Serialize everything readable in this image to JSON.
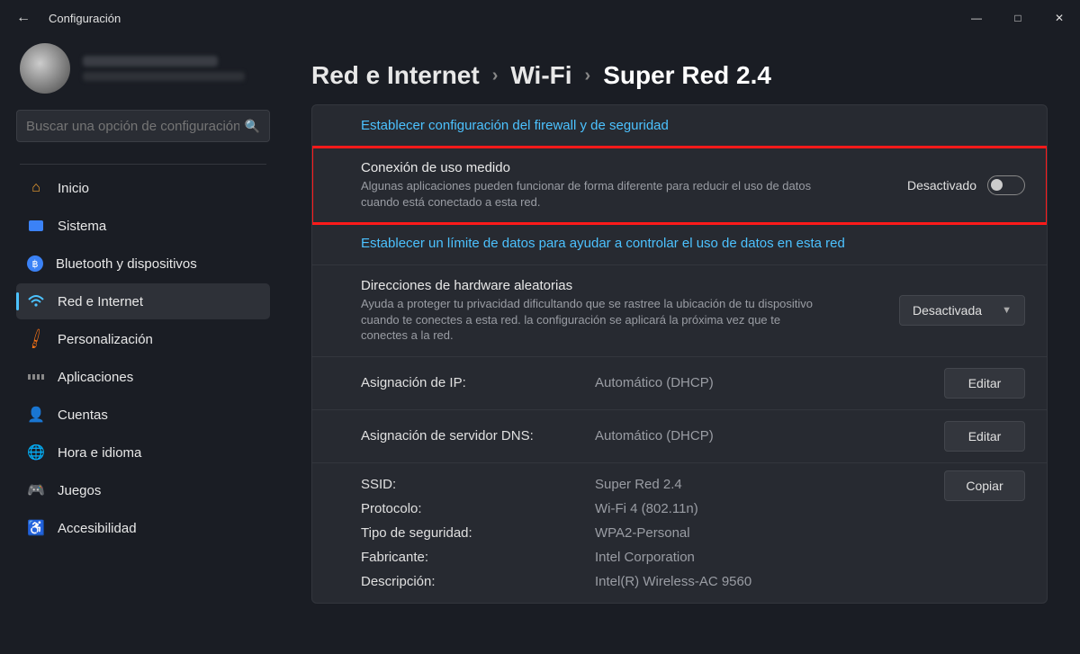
{
  "window": {
    "title": "Configuración",
    "back_tooltip": "Atrás"
  },
  "sidebar": {
    "search_placeholder": "Buscar una opción de configuración",
    "items": [
      {
        "label": "Inicio",
        "icon": "home-icon"
      },
      {
        "label": "Sistema",
        "icon": "system-icon"
      },
      {
        "label": "Bluetooth y dispositivos",
        "icon": "bluetooth-icon"
      },
      {
        "label": "Red e Internet",
        "icon": "network-icon"
      },
      {
        "label": "Personalización",
        "icon": "brush-icon"
      },
      {
        "label": "Aplicaciones",
        "icon": "apps-icon"
      },
      {
        "label": "Cuentas",
        "icon": "account-icon"
      },
      {
        "label": "Hora e idioma",
        "icon": "time-icon"
      },
      {
        "label": "Juegos",
        "icon": "games-icon"
      },
      {
        "label": "Accesibilidad",
        "icon": "accessibility-icon"
      }
    ],
    "active_index": 3
  },
  "breadcrumb": {
    "crumb1": "Red e Internet",
    "crumb2": "Wi-Fi",
    "current": "Super Red 2.4"
  },
  "content": {
    "firewall_link": "Establecer configuración del firewall y de seguridad",
    "metered": {
      "title": "Conexión de uso medido",
      "desc": "Algunas aplicaciones pueden funcionar de forma diferente para reducir el uso de datos cuando está conectado a esta red.",
      "state": "Desactivado"
    },
    "data_limit_link": "Establecer un límite de datos para ayudar a controlar el uso de datos en esta red",
    "random_hw": {
      "title": "Direcciones de hardware aleatorias",
      "desc": "Ayuda a proteger tu privacidad dificultando que se rastree la ubicación de tu dispositivo cuando te conectes a esta red. la configuración se aplicará la próxima vez que te conectes a la red.",
      "value": "Desactivada"
    },
    "ip_assignment": {
      "label": "Asignación de IP:",
      "value": "Automático (DHCP)",
      "button": "Editar"
    },
    "dns_assignment": {
      "label": "Asignación de servidor DNS:",
      "value": "Automático (DHCP)",
      "button": "Editar"
    },
    "details": {
      "copy_button": "Copiar",
      "rows": [
        {
          "k": "SSID:",
          "v": "Super Red 2.4"
        },
        {
          "k": "Protocolo:",
          "v": "Wi-Fi 4 (802.11n)"
        },
        {
          "k": "Tipo de seguridad:",
          "v": "WPA2-Personal"
        },
        {
          "k": "Fabricante:",
          "v": "Intel Corporation"
        },
        {
          "k": "Descripción:",
          "v": "Intel(R) Wireless-AC 9560"
        }
      ]
    }
  }
}
